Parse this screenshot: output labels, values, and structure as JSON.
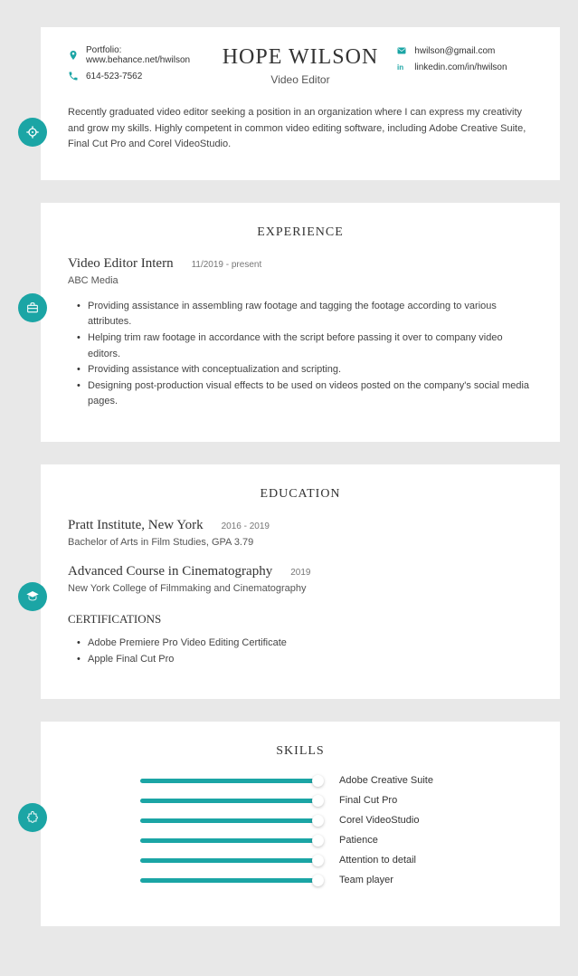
{
  "header": {
    "name": "HOPE WILSON",
    "title": "Video Editor",
    "portfolio_label": "Portfolio: www.behance.net/hwilson",
    "phone": "614-523-7562",
    "email": "hwilson@gmail.com",
    "linkedin": "linkedin.com/in/hwilson",
    "summary": "Recently graduated video editor seeking a position in an organization where I can express my creativity and grow my skills. Highly competent in common video editing software, including Adobe Creative Suite, Final Cut Pro and Corel VideoStudio."
  },
  "experience": {
    "heading": "EXPERIENCE",
    "jobs": [
      {
        "title": "Video Editor Intern",
        "dates": "11/2019 - present",
        "org": "ABC Media",
        "bullets": [
          "Providing assistance in assembling raw footage and tagging the footage according to various attributes.",
          "Helping trim raw footage in accordance with the script before passing it over to company video editors.",
          "Providing assistance with conceptualization and scripting.",
          "Designing post-production visual effects to be used on videos posted on the company's social media pages."
        ]
      }
    ]
  },
  "education": {
    "heading": "EDUCATION",
    "items": [
      {
        "title": "Pratt Institute, New York",
        "dates": "2016 - 2019",
        "detail": "Bachelor of Arts in Film Studies, GPA 3.79"
      },
      {
        "title": "Advanced Course in Cinematography",
        "dates": "2019",
        "detail": "New York College of Filmmaking and Cinematography"
      }
    ],
    "cert_heading": "CERTIFICATIONS",
    "certs": [
      "Adobe Premiere Pro Video Editing Certificate",
      "Apple Final Cut Pro"
    ]
  },
  "skills": {
    "heading": "SKILLS",
    "items": [
      {
        "label": "Adobe Creative Suite",
        "pct": 95
      },
      {
        "label": "Final Cut Pro",
        "pct": 95
      },
      {
        "label": "Corel VideoStudio",
        "pct": 95
      },
      {
        "label": "Patience",
        "pct": 95
      },
      {
        "label": "Attention to detail",
        "pct": 95
      },
      {
        "label": "Team player",
        "pct": 95
      }
    ]
  },
  "colors": {
    "teal": "#1ba5a5"
  }
}
